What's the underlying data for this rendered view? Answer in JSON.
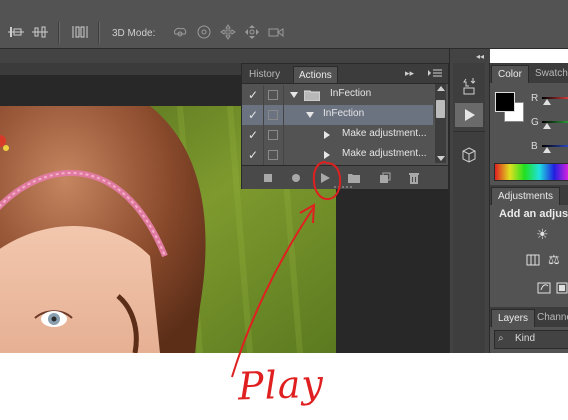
{
  "options_bar": {
    "mode_label": "3D Mode:",
    "icons": [
      "align-left-edges-icon",
      "align-horizontal-centers-icon",
      "distribute-icon",
      "rotate-3d-icon",
      "roll-3d-icon",
      "drag-3d-icon",
      "slide-3d-icon",
      "scale-3d-icon"
    ]
  },
  "actions_panel": {
    "tabs": [
      {
        "label": "History",
        "active": false
      },
      {
        "label": "Actions",
        "active": true
      }
    ],
    "rows": [
      {
        "checked": true,
        "dialog": true,
        "expanded": true,
        "kind": "set",
        "label": "InFection",
        "selected": false
      },
      {
        "checked": true,
        "dialog": true,
        "expanded": true,
        "kind": "action",
        "label": "InFection",
        "selected": true
      },
      {
        "checked": true,
        "dialog": false,
        "expanded": false,
        "kind": "step",
        "label": "Make adjustment...",
        "selected": false
      },
      {
        "checked": true,
        "dialog": false,
        "expanded": false,
        "kind": "step",
        "label": "Make adjustment...",
        "selected": false
      }
    ],
    "footer_buttons": [
      "stop-icon",
      "record-icon",
      "play-icon",
      "new-set-icon",
      "new-action-icon",
      "delete-icon"
    ]
  },
  "color_panel": {
    "tabs": [
      {
        "label": "Color",
        "active": true
      },
      {
        "label": "Swatch",
        "active": false
      }
    ],
    "sliders": [
      {
        "label": "R",
        "color": "#d03a3a"
      },
      {
        "label": "G",
        "color": "#2e9a3a"
      },
      {
        "label": "B",
        "color": "#2a48c0"
      }
    ],
    "foreground": "#000000",
    "background": "#ffffff"
  },
  "adjustments_panel": {
    "tab": "Adjustments",
    "heading": "Add an adjustm"
  },
  "layers_panel": {
    "tabs": [
      {
        "label": "Layers",
        "active": true
      },
      {
        "label": "Channe",
        "active": false
      }
    ],
    "filter_label": "Kind"
  },
  "annotation": {
    "label": "Play",
    "color": "#e02020"
  }
}
